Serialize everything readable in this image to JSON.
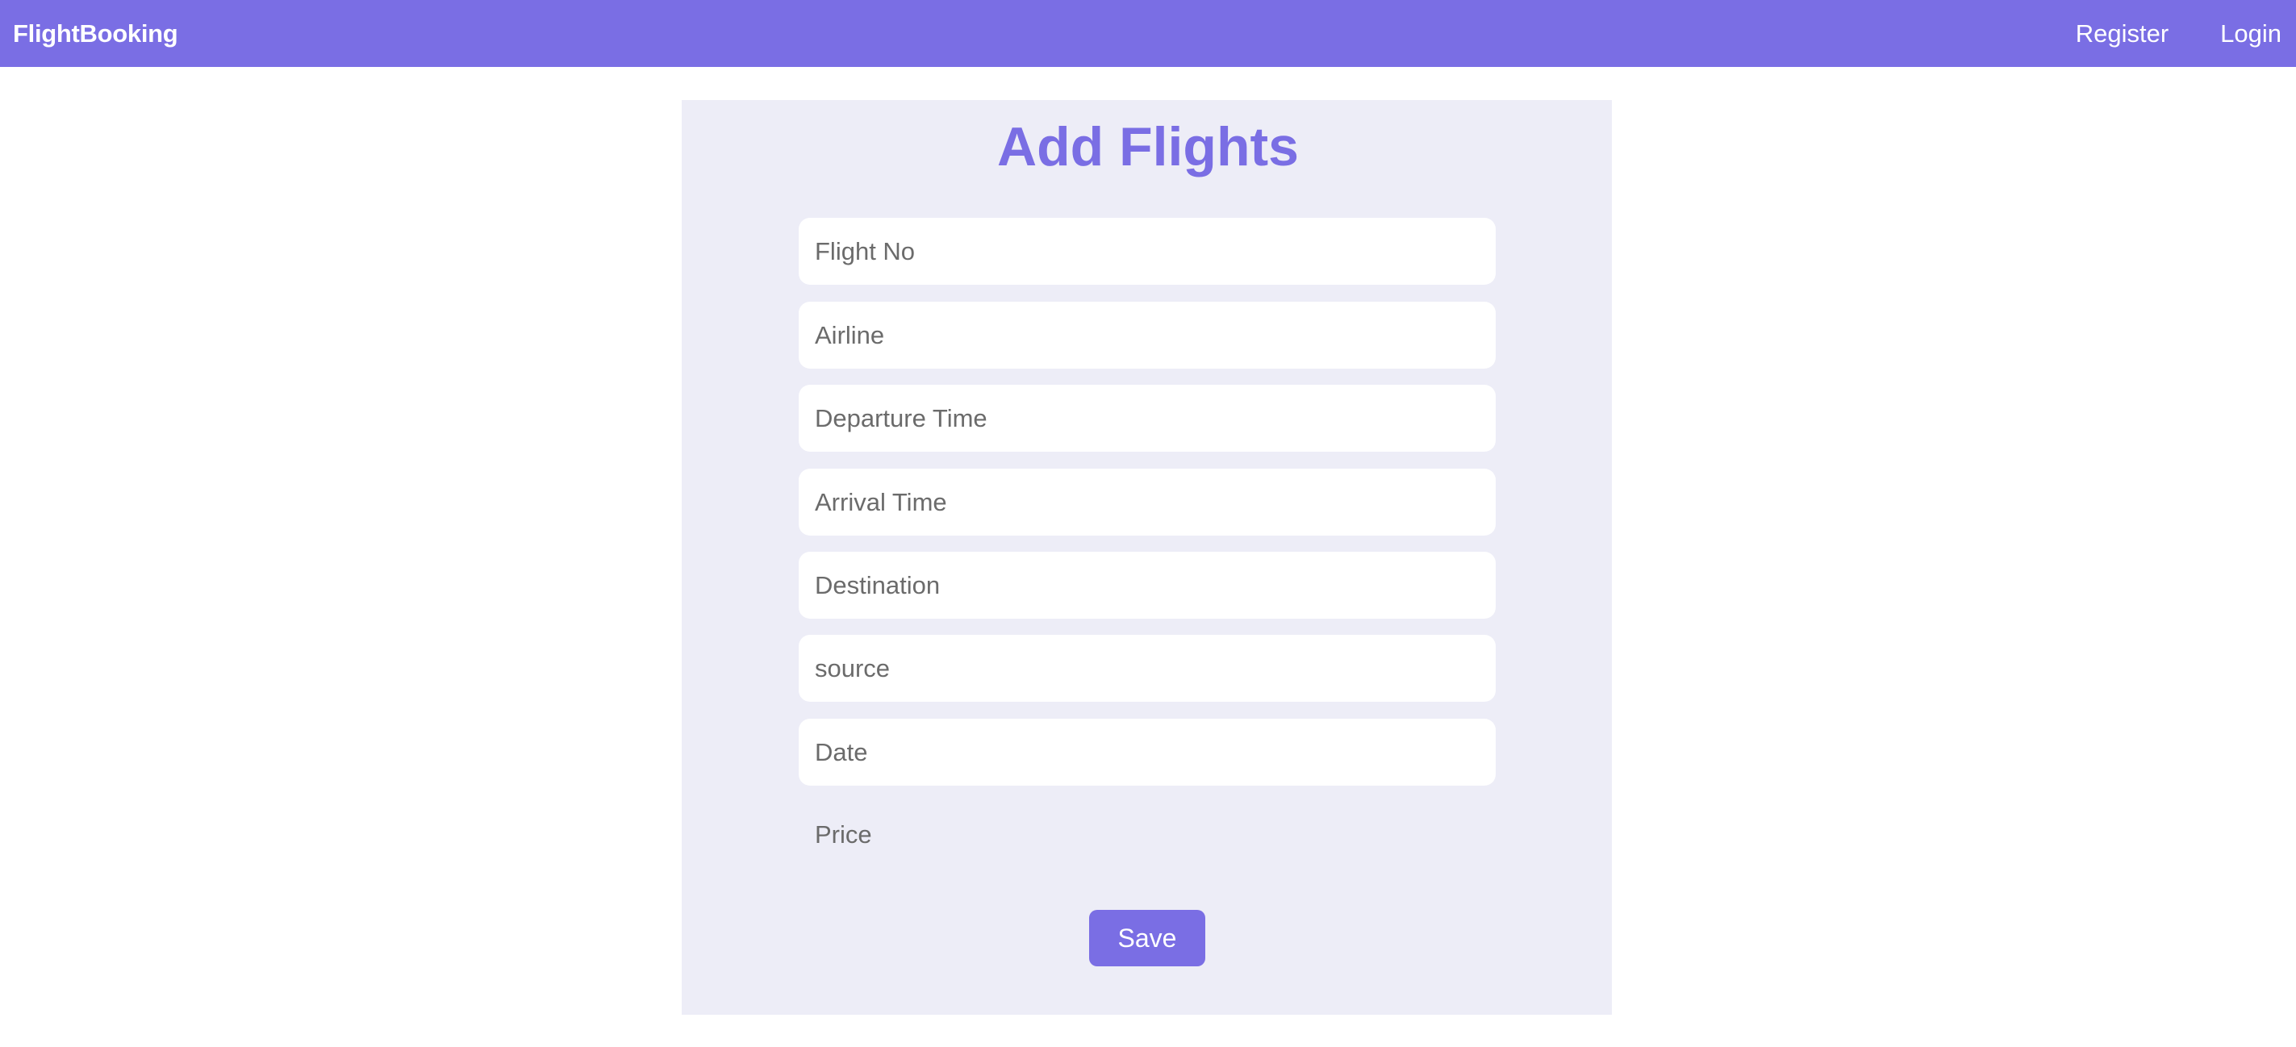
{
  "navbar": {
    "brand": "FlightBooking",
    "links": [
      "Register",
      "Login"
    ]
  },
  "form": {
    "title": "Add Flights",
    "fields": [
      {
        "placeholder": "Flight No",
        "value": ""
      },
      {
        "placeholder": "Airline",
        "value": ""
      },
      {
        "placeholder": "Departure Time",
        "value": ""
      },
      {
        "placeholder": "Arrival Time",
        "value": ""
      },
      {
        "placeholder": "Destination",
        "value": ""
      },
      {
        "placeholder": "source",
        "value": ""
      },
      {
        "placeholder": "Date",
        "value": ""
      },
      {
        "placeholder": "Price",
        "value": ""
      }
    ],
    "save_label": "Save"
  },
  "colors": {
    "accent": "#7a6ee4",
    "panel_background": "#ededf7",
    "field_background": "#ffffff"
  }
}
